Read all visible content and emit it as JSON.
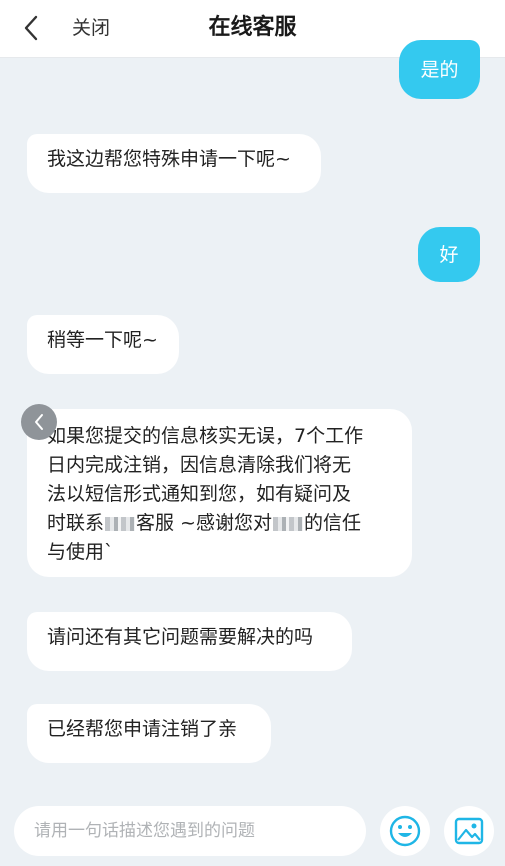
{
  "header": {
    "back_icon": "chevron-left-icon",
    "close_label": "关闭",
    "title": "在线客服"
  },
  "colors": {
    "user_bubble": "#34c9ef",
    "bot_bubble": "#ffffff",
    "background": "#ecf1f5",
    "icon_accent": "#1fb6e6"
  },
  "messages": [
    {
      "from": "user",
      "text": "是的"
    },
    {
      "from": "agent",
      "text": "我这边帮您特殊申请一下呢~"
    },
    {
      "from": "user",
      "text": "好"
    },
    {
      "from": "agent",
      "text": "稍等一下呢~"
    },
    {
      "from": "agent",
      "line1": "如果您提交的信息核实无误，7个工作",
      "line2": "日内完成注销，因信息清除我们将无",
      "line3": "法以短信形式通知到您，如有疑问及",
      "line4_a": "时联系",
      "line4_b": "客服 ~感谢您对",
      "line4_c": "的信任",
      "line5": "与使用`"
    },
    {
      "from": "agent",
      "text": "请问还有其它问题需要解决的吗"
    },
    {
      "from": "agent",
      "text": "已经帮您申请注销了亲"
    }
  ],
  "side_arrow_icon": "chevron-left-icon",
  "composer": {
    "placeholder": "请用一句话描述您遇到的问题",
    "emoji_icon": "smiley-icon",
    "image_icon": "image-icon"
  }
}
